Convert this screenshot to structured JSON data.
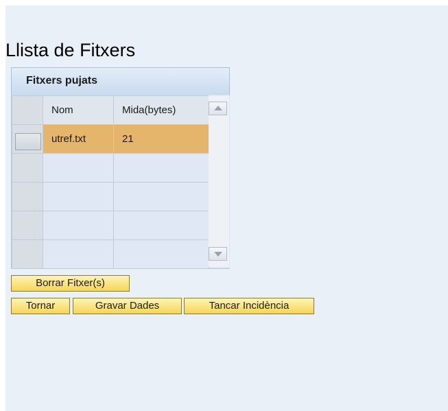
{
  "page": {
    "title": "Llista de Fitxers"
  },
  "grid": {
    "caption": "Fitxers pujats",
    "columns": [
      "Nom",
      "Mida(bytes)"
    ],
    "rows": [
      {
        "name": "utref.txt",
        "size": "21",
        "selected": true
      },
      {
        "name": "",
        "size": "",
        "selected": false
      },
      {
        "name": "",
        "size": "",
        "selected": false
      },
      {
        "name": "",
        "size": "",
        "selected": false
      },
      {
        "name": "",
        "size": "",
        "selected": false
      }
    ],
    "scroll_up_icon": "triangle-up",
    "scroll_down_icon": "triangle-down"
  },
  "buttons": {
    "delete_label": "Borrar Fitxer(s)",
    "back_label": "Tornar",
    "save_label": "Gravar Dades",
    "close_label": "Tancar Incidència"
  },
  "colors": {
    "background": "#eaf0f7",
    "selected_row": "#e4b56a",
    "button_fill": "#f5d656",
    "header_fill": "#c8dbef"
  }
}
